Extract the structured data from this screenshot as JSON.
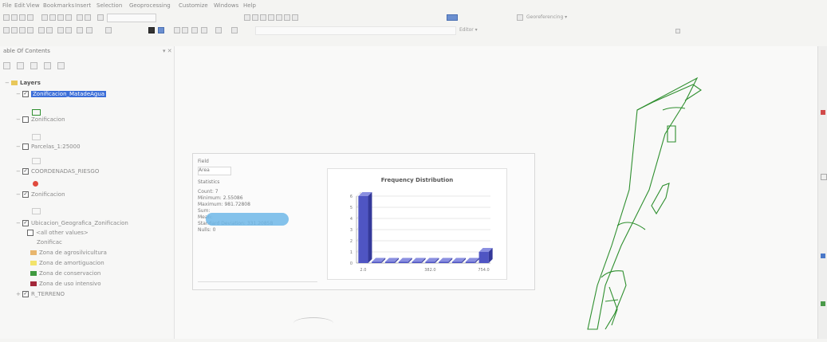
{
  "menu": [
    "File",
    "Edit",
    "View",
    "Bookmarks",
    "Insert",
    "Selection",
    "Geoprocessing",
    "Customize",
    "Windows",
    "Help"
  ],
  "toolbar": {
    "georeferencing_label": "Georeferencing ▾",
    "editor_label": "Editor ▾"
  },
  "toc": {
    "title": "able Of Contents",
    "root_label": "Layers",
    "layers": [
      {
        "label": "Zonificacion_MatadeAgua",
        "checked": true,
        "selected": true,
        "symbol": "green-square"
      },
      {
        "label": "Zonificacion",
        "checked": false,
        "symbol": "none"
      },
      {
        "label": "Parcelas_1:25000",
        "checked": false,
        "symbol": "none"
      },
      {
        "label": "COORDENADAS_RIESGO",
        "checked": true,
        "symbol": "red-dot"
      },
      {
        "label": "Zonificacion",
        "checked": true,
        "symbol": "none"
      },
      {
        "label": "Ubicacion_Geografica_Zonificacion",
        "checked": true,
        "symbol": "none"
      },
      {
        "label": "<all other values>",
        "checked": null,
        "symbol": "none"
      },
      {
        "label": "Zonificac",
        "checked": null,
        "symbol": "none"
      }
    ],
    "legend": [
      {
        "label": "Zona de agrosilvicultura",
        "color": "#e8b66e"
      },
      {
        "label": "Zona de amortiguacion",
        "color": "#f2e36a"
      },
      {
        "label": "Zona de conservacion",
        "color": "#3f9a3f"
      },
      {
        "label": "Zona de uso intensivo",
        "color": "#a3283a"
      }
    ],
    "last_layer": "R_TERRENO"
  },
  "dialog": {
    "field_label": "Field",
    "field_value": "Area",
    "stats_header": "Statistics",
    "stats": [
      "Count:   7",
      "Minimum: 2.55086",
      "Maximum: 981.72808",
      "Sum:",
      "Mean:",
      "Standard Deviation: 331.20858",
      "Nulls:   0"
    ]
  },
  "chart_data": {
    "type": "bar",
    "title": "Frequency Distribution",
    "x_tick_labels": [
      "2.0",
      "382.0",
      "754.0"
    ],
    "y_ticks": [
      0,
      1,
      2,
      3,
      4,
      5,
      6
    ],
    "values": [
      6,
      0,
      0,
      0,
      0,
      0,
      0,
      0,
      0,
      1
    ],
    "ylim": [
      0,
      6
    ],
    "bar_color": "#4f55c3"
  },
  "colors": {
    "selection": "#3b6ed8",
    "map_outline": "#2f8f2f"
  }
}
